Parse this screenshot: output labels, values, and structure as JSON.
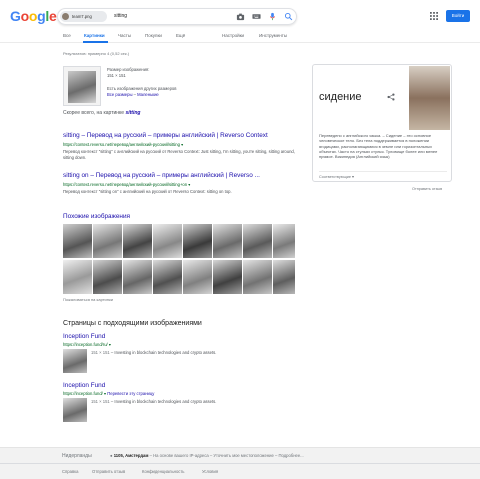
{
  "header": {
    "logo_letters": [
      {
        "ch": "G",
        "color": "#4285f4"
      },
      {
        "ch": "o",
        "color": "#ea4335"
      },
      {
        "ch": "o",
        "color": "#fbbc05"
      },
      {
        "ch": "g",
        "color": "#4285f4"
      },
      {
        "ch": "l",
        "color": "#34a853"
      },
      {
        "ch": "e",
        "color": "#ea4335"
      }
    ],
    "image_chip": "team7.png",
    "query": "sitting",
    "sign_in": "Войти",
    "accent": "#1a73e8"
  },
  "tabs": {
    "all": "Все",
    "images": "Картинки",
    "videos": "Часты",
    "shopping": "Покупки",
    "more": "Ещё",
    "settings": "Настройки",
    "tools": "Инструменты"
  },
  "stats": "Результатов: примерно 4 (0,52 сек.)",
  "image_result": {
    "size_label": "Размер изображения:",
    "size_value": "151 × 151",
    "other_sizes": "Есть изображения других размеров",
    "all_sizes": "Все размеры",
    "small": "Маленькие",
    "best_guess_prefix": "Скорее всего, на картинке",
    "best_guess_term": "sitting"
  },
  "results": [
    {
      "title": "sitting – Перевод на русский – примеры английский | Reverso Context",
      "url": "https://context.reverso.net/перевод/английский-русский/sitting",
      "snippet": "Перевод контекст \"sitting\" с английский на русский от Reverso Context: Just sitting, I'm sitting, you're sitting, sitting around, sitting down."
    },
    {
      "title": "sitting on – Перевод на русский – примеры английский | Reverso ...",
      "url": "https://context.reverso.net/перевод/английский-русский/sitting+on",
      "snippet": "Перевод контекст \"sitting on\" с английский на русский от Reverso Context: sitting on top."
    }
  ],
  "similar": {
    "heading": "Похожие изображения",
    "report": "Пожаловаться на картинки"
  },
  "pages": {
    "heading": "Страницы с подходящими изображениями",
    "items": [
      {
        "title": "Inception Fund",
        "url": "https://inception.fund/ru/",
        "size": "151 × 151",
        "desc": "Investing in blockchain technologies and crypto assets."
      },
      {
        "title": "Inception Fund",
        "url": "https://inception.fund/",
        "translate": "Перевести эту страницу",
        "size": "151 × 151",
        "desc": "Investing in blockchain technologies and crypto assets."
      }
    ]
  },
  "knowledge_panel": {
    "title": "сидение",
    "text": "Переведено с английского языка. – Сидение – это основное человеческое тело. Без тела поддерживается в положении ягодицами, располагающимися в земле или горизонтальных объектах. Часто на стульях стулья. Туловище более или менее прямое. Википедия (Английский язык)",
    "more": "Соответствующие",
    "feedback": "Отправить отзыв"
  },
  "footer": {
    "country": "Нидерланды",
    "location_bold": "1105, Амстердам",
    "location_rest": "– На основе вашего IP-адреса – Уточнить мое местоположение – Подробнее...",
    "links": [
      "Справка",
      "Отправить отзыв",
      "Конфиденциальность",
      "Условия"
    ]
  }
}
